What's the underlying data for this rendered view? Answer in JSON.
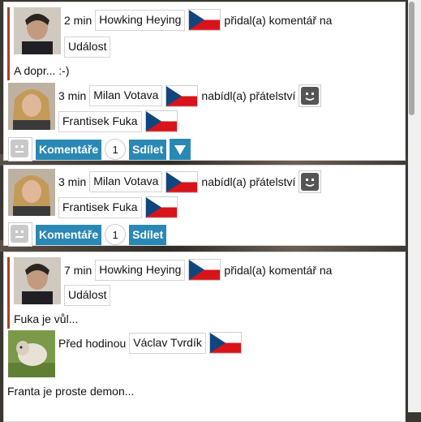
{
  "feed": [
    {
      "time": "2 min",
      "author": "Howking Heying",
      "action": "přidal(a) komentář na",
      "target": "Událost",
      "comment": "A dopr... :-)",
      "sub": {
        "time": "3 min",
        "author": "Milan Votava",
        "action": "nabídl(a) přátelství",
        "target": "Frantisek Fuka",
        "buttons": {
          "comments": "Komentáře",
          "count": "1",
          "share": "Sdílet"
        }
      }
    },
    {
      "time": "3 min",
      "author": "Milan Votava",
      "action": "nabídl(a) přátelství",
      "target": "Frantisek Fuka",
      "buttons": {
        "comments": "Komentáře",
        "count": "1",
        "share": "Sdílet"
      }
    },
    {
      "time": "7 min",
      "author": "Howking Heying",
      "action": "přidal(a) komentář na",
      "target": "Událost",
      "comment": "Fuka je vůl...",
      "reply": {
        "time": "Před hodinou",
        "author": "Václav Tvrdík",
        "text": "Franta je proste demon..."
      }
    }
  ],
  "colors": {
    "accent": "#2a88b4",
    "bar": "#a8412a",
    "dot": "#d02020"
  }
}
